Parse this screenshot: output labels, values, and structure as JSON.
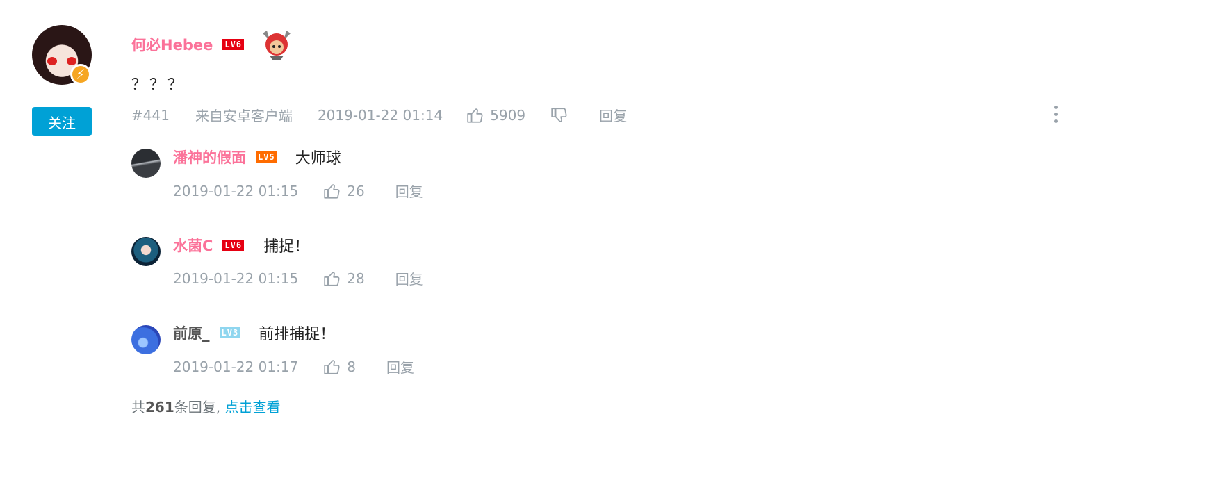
{
  "main_comment": {
    "username": "何必Hebee",
    "level": "LV6",
    "follow_label": "关注",
    "content": "？？？",
    "floor": "#441",
    "source": "来自安卓客户端",
    "time": "2019-01-22 01:14",
    "likes": "5909",
    "reply_label": "回复"
  },
  "replies": [
    {
      "username": "潘神的假面",
      "level": "LV5",
      "content": "大师球",
      "time": "2019-01-22 01:15",
      "likes": "26",
      "reply_label": "回复"
    },
    {
      "username": "水菌C",
      "level": "LV6",
      "content": "捕捉！",
      "time": "2019-01-22 01:15",
      "likes": "28",
      "reply_label": "回复"
    },
    {
      "username": "前原_",
      "level": "LV3",
      "content": "前排捕捉！",
      "time": "2019-01-22 01:17",
      "likes": "8",
      "reply_label": "回复"
    }
  ],
  "footer": {
    "prefix": "共",
    "count": "261",
    "suffix": "条回复,",
    "view_label": "点击查看"
  },
  "colors": {
    "accent": "#00a1d6",
    "vip_name": "#fb7299",
    "meta_gray": "#99a2aa",
    "lv6": "#e60012",
    "lv5": "#ff6c00",
    "lv3": "#8fd6ef",
    "badge_orange": "#f6a623"
  },
  "icons": [
    "lightning-icon",
    "thumbs-up-icon",
    "thumbs-down-icon",
    "more-vertical-icon"
  ]
}
